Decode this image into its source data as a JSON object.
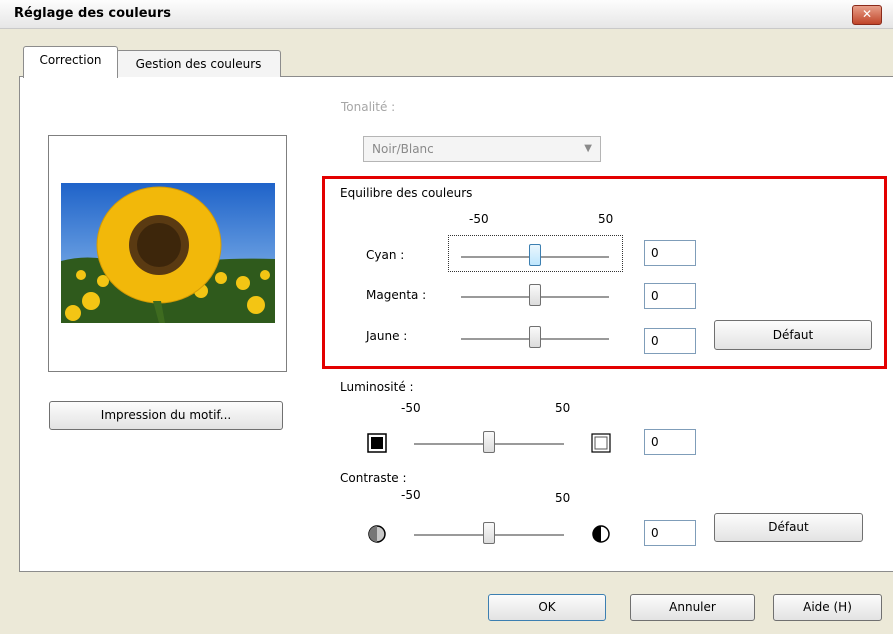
{
  "window": {
    "title": "Réglage des couleurs",
    "close_glyph": "✕"
  },
  "tabs": [
    {
      "label": "Correction",
      "active": true
    },
    {
      "label": "Gestion des couleurs",
      "active": false
    }
  ],
  "preview": {
    "image": "sunflower-photo",
    "pattern_button": "Impression du motif..."
  },
  "tone": {
    "label": "Tonalité :",
    "value": "Noir/Blanc",
    "enabled": false
  },
  "color_balance": {
    "title": "Equilibre des couleurs",
    "min_label": "-50",
    "max_label": "50",
    "sliders": [
      {
        "label": "Cyan :",
        "value": "0"
      },
      {
        "label": "Magenta :",
        "value": "0"
      },
      {
        "label": "Jaune :",
        "value": "0"
      }
    ],
    "default_button": "Défaut"
  },
  "brightness": {
    "label": "Luminosité :",
    "min_label": "-50",
    "max_label": "50",
    "value": "0"
  },
  "contrast": {
    "label": "Contraste :",
    "min_label": "-50",
    "max_label": "50",
    "value": "0",
    "default_button": "Défaut"
  },
  "footer": {
    "ok": "OK",
    "cancel": "Annuler",
    "help": "Aide (H)"
  },
  "colors": {
    "highlight_box": "#e30000",
    "focus_thumb": "#bee6fd"
  }
}
